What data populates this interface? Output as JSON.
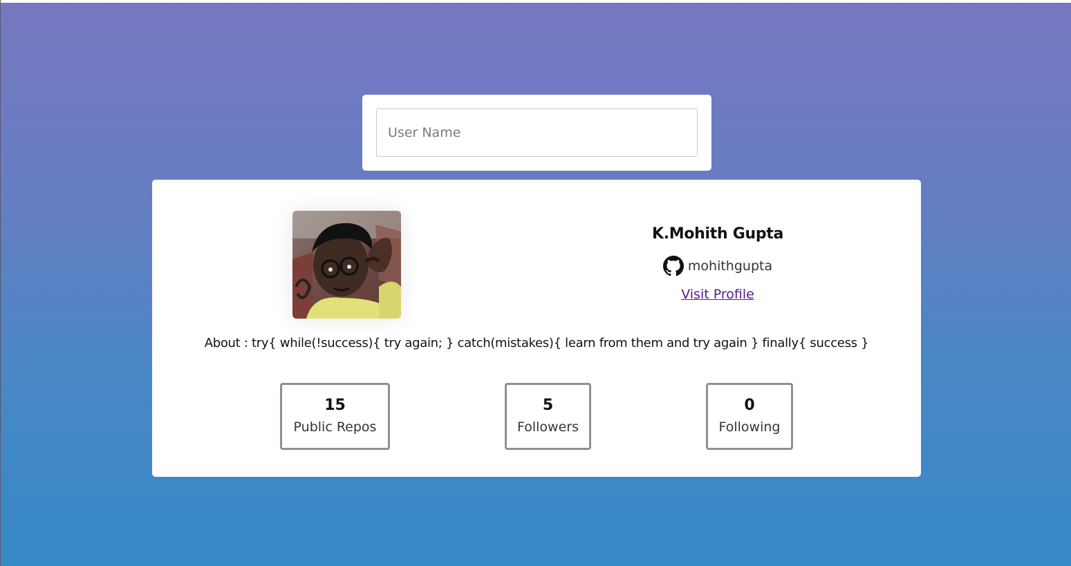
{
  "search": {
    "placeholder": "User Name",
    "value": ""
  },
  "profile": {
    "name": "K.Mohith Gupta",
    "login": "mohithgupta",
    "login_icon": "github-icon",
    "visit_label": "Visit Profile",
    "about": "About : try{ while(!success){ try again; } catch(mistakes){ learn from them and try again } finally{ success }",
    "avatar": "user-avatar-photo"
  },
  "stats": [
    {
      "value": "15",
      "label": "Public Repos"
    },
    {
      "value": "5",
      "label": "Followers"
    },
    {
      "value": "0",
      "label": "Following"
    }
  ],
  "colors": {
    "gradient_top": "#7777c1",
    "gradient_bottom": "#3689c7",
    "link": "#551a8b",
    "stat_border": "#8f8f8f"
  }
}
